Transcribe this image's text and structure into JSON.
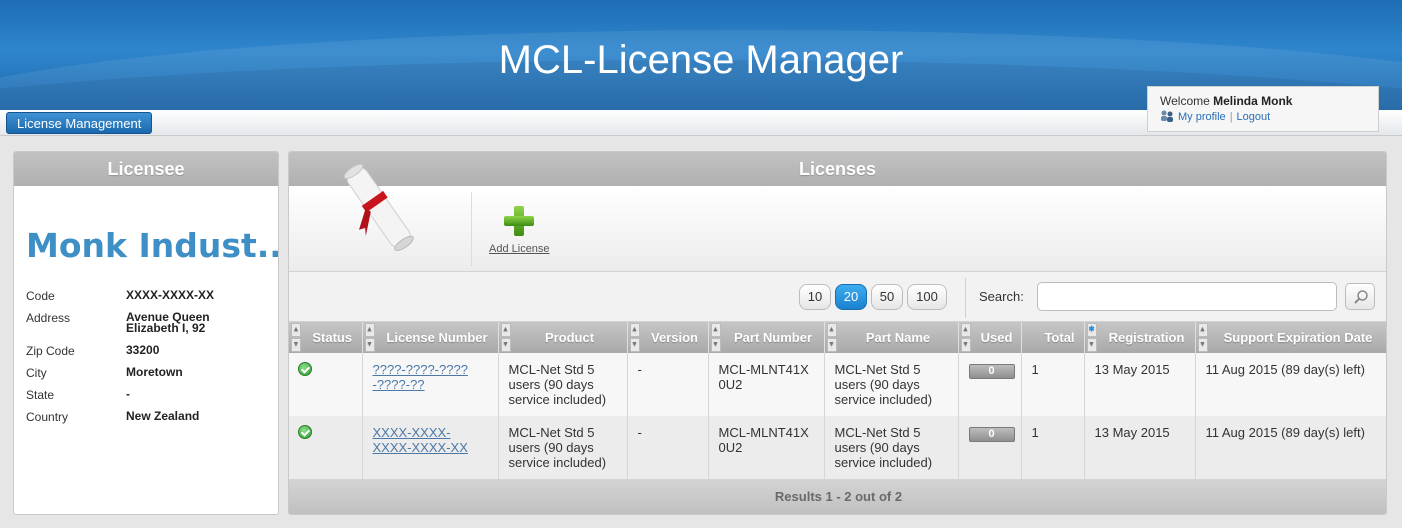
{
  "header": {
    "title": "MCL-License Manager"
  },
  "nav": {
    "license_management": "License Management"
  },
  "user": {
    "welcome": "Welcome",
    "name": "Melinda Monk",
    "my_profile": "My profile",
    "separator": "|",
    "logout": "Logout"
  },
  "licensee": {
    "heading": "Licensee",
    "company": "Monk Indust...",
    "fields": [
      {
        "label": "Code",
        "value": "XXXX-XXXX-XX"
      },
      {
        "label": "Address",
        "value": "Avenue Queen Elizabeth I, 92"
      },
      {
        "label": "Zip Code",
        "value": "33200"
      },
      {
        "label": "City",
        "value": "Moretown"
      },
      {
        "label": "State",
        "value": "-"
      },
      {
        "label": "Country",
        "value": "New Zealand"
      }
    ]
  },
  "licenses": {
    "heading": "Licenses",
    "add_license": "Add License",
    "page_sizes": [
      "10",
      "20",
      "50",
      "100"
    ],
    "active_page_size": "20",
    "search_label": "Search:",
    "search_value": "",
    "columns": [
      "Status",
      "License Number",
      "Product",
      "Version",
      "Part Number",
      "Part Name",
      "Used",
      "Total",
      "Registration",
      "Support Expiration Date"
    ],
    "rows": [
      {
        "status": "ok",
        "license_number": "????-????-????-????-??",
        "product": "MCL-Net Std 5 users (90 days service included)",
        "version": "-",
        "part_number": "MCL-MLNT41X0U2",
        "part_name": "MCL-Net Std 5 users (90 days service included)",
        "used": "0",
        "total": "1",
        "registration": "13 May 2015",
        "support_expiration": "11 Aug 2015 (89 day(s) left)"
      },
      {
        "status": "ok",
        "license_number": "XXXX-XXXX-XXXX-XXXX-XX",
        "product": "MCL-Net Std 5 users (90 days service included)",
        "version": "-",
        "part_number": "MCL-MLNT41X0U2",
        "part_name": "MCL-Net Std 5 users (90 days service included)",
        "used": "0",
        "total": "1",
        "registration": "13 May 2015",
        "support_expiration": "11 Aug 2015 (89 day(s) left)"
      }
    ],
    "results_text": "Results 1 - 2 out of 2"
  },
  "colors": {
    "header_blue": "#1d6db4",
    "accent_blue": "#3e8fc6",
    "active_page": "#1a82cf",
    "panel_head": "#b0b0b0"
  }
}
